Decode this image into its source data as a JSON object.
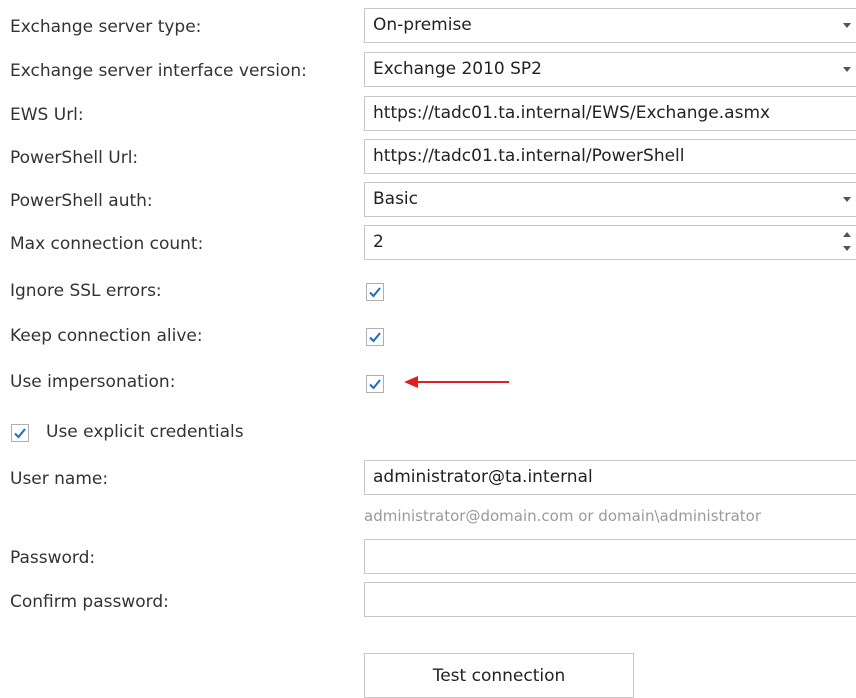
{
  "colors": {
    "check": "#1a6fc4",
    "arrow": "#e02020",
    "border": "#c8c8c8",
    "hint": "#9a9a9a"
  },
  "form": {
    "server_type": {
      "label": "Exchange server type:",
      "value": "On-premise"
    },
    "interface_version": {
      "label": "Exchange server interface version:",
      "value": "Exchange 2010 SP2"
    },
    "ews_url": {
      "label": "EWS Url:",
      "value": "https://tadc01.ta.internal/EWS/Exchange.asmx"
    },
    "powershell_url": {
      "label": "PowerShell Url:",
      "value": "https://tadc01.ta.internal/PowerShell"
    },
    "powershell_auth": {
      "label": "PowerShell auth:",
      "value": "Basic"
    },
    "max_connection": {
      "label": "Max connection count:",
      "value": "2"
    },
    "ignore_ssl": {
      "label": "Ignore SSL errors:",
      "checked": true
    },
    "keep_alive": {
      "label": "Keep connection alive:",
      "checked": true
    },
    "impersonation": {
      "label": "Use impersonation:",
      "checked": true
    },
    "explicit_credentials": {
      "label": "Use explicit credentials",
      "checked": true
    },
    "user_name": {
      "label": "User name:",
      "value": "administrator@ta.internal",
      "hint": "administrator@domain.com or domain\\administrator"
    },
    "password": {
      "label": "Password:",
      "value": ""
    },
    "confirm_password": {
      "label": "Confirm password:",
      "value": ""
    }
  },
  "buttons": {
    "test_connection": "Test connection"
  }
}
